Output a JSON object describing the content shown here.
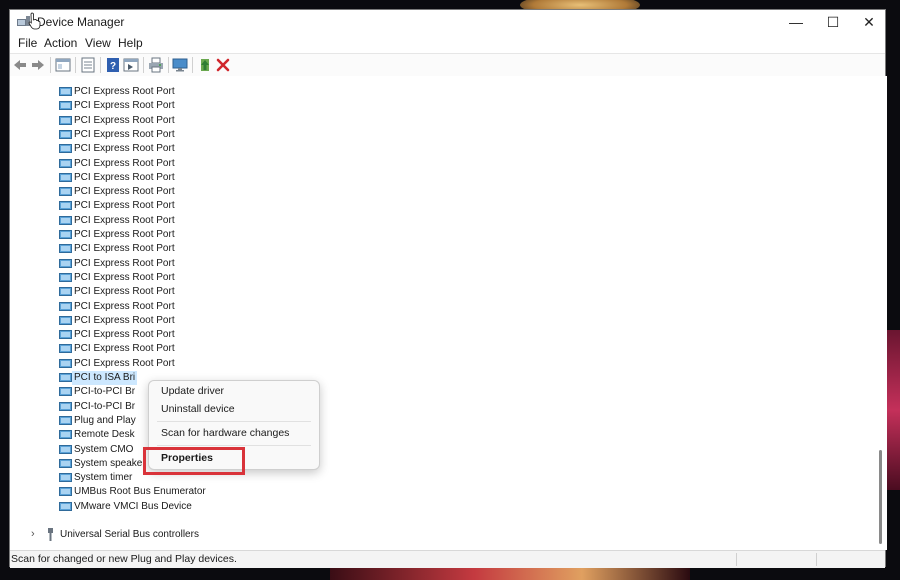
{
  "window": {
    "title": "Device Manager",
    "controls": {
      "minimize": "—",
      "maximize": "☐",
      "close": "✕"
    }
  },
  "menu": [
    "File",
    "Action",
    "View",
    "Help"
  ],
  "toolbar_icons": [
    "back-arrow-icon",
    "forward-arrow-icon",
    "show-hide-tree-icon",
    "properties-icon",
    "help-icon",
    "action-pane-icon",
    "print-icon",
    "monitor-icon",
    "update-driver-icon",
    "uninstall-icon"
  ],
  "tree": {
    "rows": [
      "PCI Express Root Port",
      "PCI Express Root Port",
      "PCI Express Root Port",
      "PCI Express Root Port",
      "PCI Express Root Port",
      "PCI Express Root Port",
      "PCI Express Root Port",
      "PCI Express Root Port",
      "PCI Express Root Port",
      "PCI Express Root Port",
      "PCI Express Root Port",
      "PCI Express Root Port",
      "PCI Express Root Port",
      "PCI Express Root Port",
      "PCI Express Root Port",
      "PCI Express Root Port",
      "PCI Express Root Port",
      "PCI Express Root Port",
      "PCI Express Root Port",
      "PCI Express Root Port",
      "PCI to ISA Bri",
      "PCI-to-PCI Br",
      "PCI-to-PCI Br",
      "Plug and Play",
      "Remote Desk",
      "System CMO",
      "System speaker",
      "System timer",
      "UMBus Root Bus Enumerator",
      "VMware VMCI Bus Device"
    ],
    "selected_index": 20,
    "category": {
      "label": "Universal Serial Bus controllers",
      "expander": "›"
    }
  },
  "context_menu": {
    "items": [
      "Update driver",
      "Uninstall device",
      "Scan for hardware changes",
      "Properties"
    ],
    "highlighted": "Properties"
  },
  "status": {
    "text": "Scan for changed or new Plug and Play devices."
  },
  "colors": {
    "selection": "#cde8ff",
    "highlight_box": "#d9333a",
    "accent": "#1e6fd0"
  }
}
